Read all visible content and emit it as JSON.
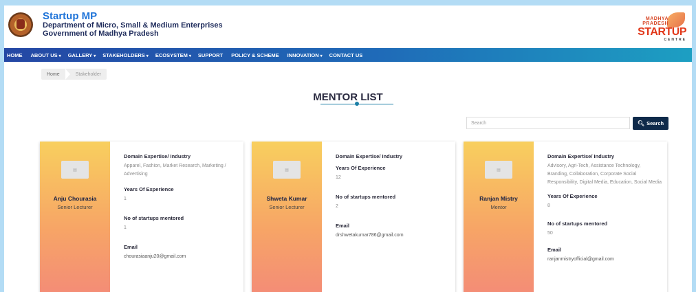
{
  "header": {
    "brand_title": "Startup MP",
    "dept": "Department of Micro, Small & Medium Enterprises",
    "govt": "Government of Madhya Pradesh",
    "logo": {
      "line1": "MADHYA",
      "line2": "PRADESH",
      "line3": "STARTUP",
      "line4": "CENTRE"
    }
  },
  "nav": [
    {
      "label": "HOME",
      "caret": ""
    },
    {
      "label": "ABOUT US",
      "caret": "▾"
    },
    {
      "label": "GALLERY",
      "caret": "▾"
    },
    {
      "label": "STAKEHOLDERS",
      "caret": "▾"
    },
    {
      "label": "ECOSYSTEM",
      "caret": "▾"
    },
    {
      "label": "SUPPORT",
      "caret": ""
    },
    {
      "label": "POLICY & SCHEME",
      "caret": ""
    },
    {
      "label": "INNOVATION",
      "caret": "▾"
    },
    {
      "label": "CONTACT US",
      "caret": ""
    }
  ],
  "breadcrumb": {
    "home": "Home",
    "current": "Stakeholder"
  },
  "page_title": "MENTOR LIST",
  "search": {
    "placeholder": "Search",
    "button": "Search"
  },
  "labels": {
    "domain": "Domain Expertise/ Industry",
    "years": "Years Of Experience",
    "mentored": "No of startups mentored",
    "email": "Email"
  },
  "mentors": [
    {
      "name": "Anju Chourasia",
      "role": "Senior Lecturer",
      "domain": "Apparel, Fashion, Market Research, Marketing / Advertising",
      "years": "1",
      "mentored": "1",
      "email": "chourasiaanju20@gmail.com"
    },
    {
      "name": "Shweta Kumar",
      "role": "Senior Lecturer",
      "domain": "",
      "years": "12",
      "mentored": "2",
      "email": "drshwetakumar786@gmail.com"
    },
    {
      "name": "Ranjan Mistry",
      "role": "Mentor",
      "domain": "Advisory, Agri-Tech, Assistance Technology, Branding, Collaboration, Corporate Social Responsibility, Digital Media, Education, Social Media",
      "years": "8",
      "mentored": "50",
      "email": "ranjanmistryofficial@gmail.com"
    }
  ],
  "colors": {
    "nav_start": "#2447a4",
    "nav_end": "#1d9fc2",
    "search_button": "#0f2a4a",
    "brand_blue": "#1e73d8",
    "card_gradient_top": "#f8cf5e",
    "card_gradient_bottom": "#f38a78"
  },
  "icons": {
    "search": "search-icon",
    "emblem": "mp-emblem-icon",
    "avatar": "avatar-placeholder-icon"
  }
}
